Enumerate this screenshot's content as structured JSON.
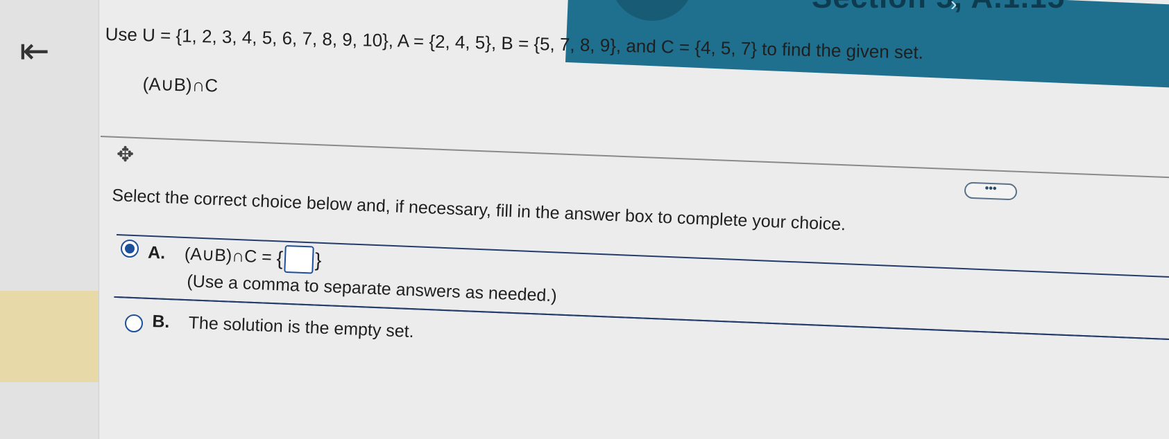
{
  "header": {
    "title_fragment": "Section 5, A.1.15",
    "back_icon": "back-to-first-icon"
  },
  "question": {
    "prompt": "Use U = {1, 2, 3, 4, 5, 6, 7, 8, 9, 10}, A = {2, 4, 5}, B = {5, 7, 8, 9}, and C = {4, 5, 7} to find the given set.",
    "expression": "(A∪B)∩C"
  },
  "more_button": {
    "label": "•••"
  },
  "instruction": "Select the correct choice below and, if necessary, fill in the answer box to complete your choice.",
  "choices": {
    "a": {
      "letter": "A.",
      "lhs": "(A∪B)∩C =",
      "open_brace": "{",
      "close_brace": "}",
      "answer_value": "",
      "note": "(Use a comma to separate answers as needed.)",
      "selected": true
    },
    "b": {
      "letter": "B.",
      "text": "The solution is the empty set.",
      "selected": false
    }
  },
  "colors": {
    "accent": "#1e4f9b",
    "header": "#1f6f8e"
  }
}
